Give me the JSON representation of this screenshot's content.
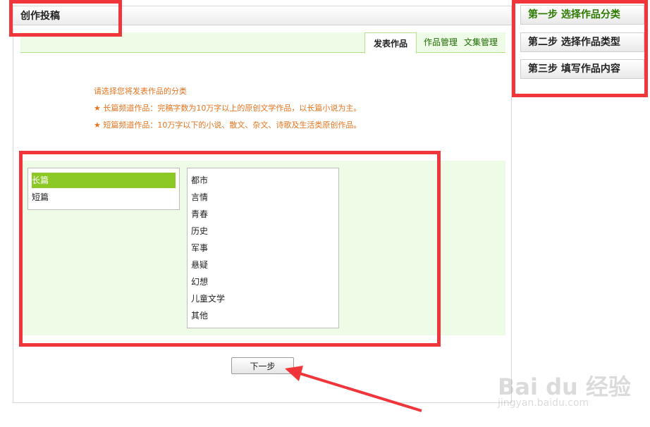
{
  "header": {
    "title": "创作投稿"
  },
  "tabs": {
    "active": "发表作品",
    "links": [
      "作品管理",
      "文集管理"
    ]
  },
  "info": {
    "prompt": "请选择您将发表作品的分类",
    "star": "★",
    "lines": [
      "长篇频道作品：完稿字数为10万字以上的原创文学作品，以长篇小说为主。",
      "短篇频道作品：10万字以下的小说、散文、杂文、诗歌及生活类原创作品。"
    ]
  },
  "category_list": {
    "items": [
      "长篇",
      "短篇"
    ],
    "selected": "长篇"
  },
  "genre_list": {
    "items": [
      "都市",
      "言情",
      "青春",
      "历史",
      "军事",
      "悬疑",
      "幻想",
      "儿童文学",
      "其他"
    ]
  },
  "next_button": {
    "label": "下一步"
  },
  "steps": [
    {
      "label": "第一步 选择作品分类",
      "current": true
    },
    {
      "label": "第二步 选择作品类型",
      "current": false
    },
    {
      "label": "第三步 填写作品内容",
      "current": false
    }
  ],
  "watermark": {
    "main": "Bai du 经验",
    "sub": "jingyan.baidu.com"
  },
  "colors": {
    "annotation": "#f0363a",
    "accent_green": "#8cc826",
    "info_orange": "#e6741e"
  }
}
